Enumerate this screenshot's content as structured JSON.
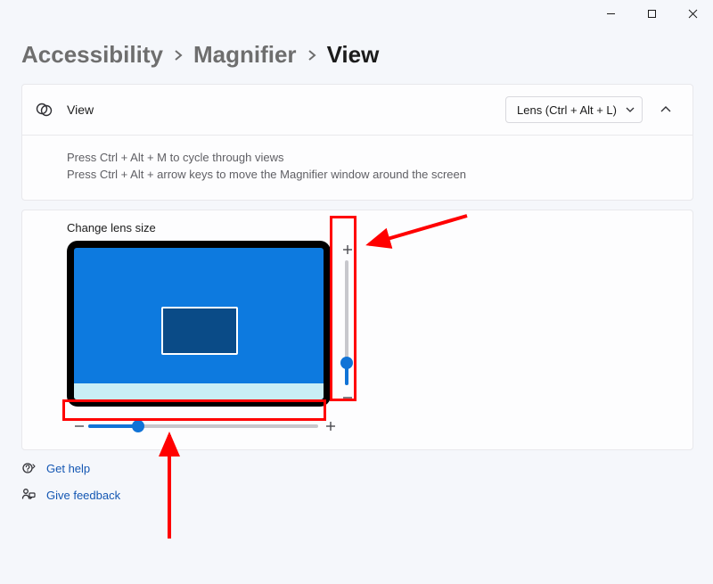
{
  "breadcrumb": {
    "root": "Accessibility",
    "mid": "Magnifier",
    "leaf": "View"
  },
  "viewCard": {
    "title": "View",
    "dropdown_selected": "Lens (Ctrl + Alt + L)",
    "hint1": "Press Ctrl + Alt + M to cycle through views",
    "hint2": "Press Ctrl + Alt + arrow keys to move the Magnifier window around the screen"
  },
  "lensCard": {
    "title": "Change lens size"
  },
  "links": {
    "help": "Get help",
    "feedback": "Give feedback"
  }
}
